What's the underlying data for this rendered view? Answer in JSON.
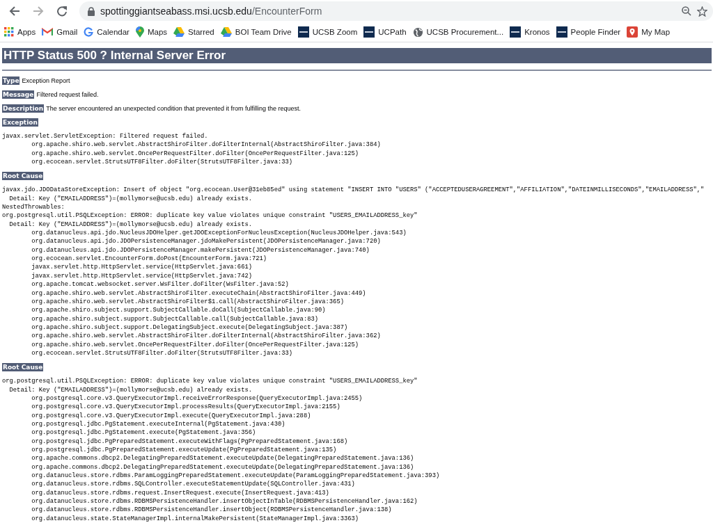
{
  "browser": {
    "back": {
      "disabled": false
    },
    "forward": {
      "disabled": true
    },
    "url": {
      "host": "spottinggiantseabass.msi.ucsb.edu",
      "path": "/EncounterForm"
    },
    "bookmarks": [
      {
        "label": "Apps",
        "kind": "apps"
      },
      {
        "label": "Gmail",
        "kind": "mail"
      },
      {
        "label": "Calendar",
        "kind": "g"
      },
      {
        "label": "Maps",
        "kind": "pin"
      },
      {
        "label": "Starred",
        "kind": "drive"
      },
      {
        "label": "BOI Team Drive",
        "kind": "drive"
      },
      {
        "label": "UCSB Zoom",
        "kind": "square"
      },
      {
        "label": "UCPath",
        "kind": "square"
      },
      {
        "label": "UCSB Procurement...",
        "kind": "globe"
      },
      {
        "label": "Kronos",
        "kind": "square"
      },
      {
        "label": "People Finder",
        "kind": "square"
      },
      {
        "label": "My Map",
        "kind": "redpin"
      }
    ]
  },
  "page": {
    "title": "HTTP Status 500 ? Internal Server Error",
    "fields": [
      {
        "label": "Type",
        "value": "Exception Report"
      },
      {
        "label": "Message",
        "value": "Filtered request failed."
      },
      {
        "label": "Description",
        "value": "The server encountered an unexpected condition that prevented it from fulfilling the request."
      }
    ],
    "sections": [
      {
        "heading": "Exception",
        "lines": [
          "javax.servlet.ServletException: Filtered request failed.",
          "\torg.apache.shiro.web.servlet.AbstractShiroFilter.doFilterInternal(AbstractShiroFilter.java:384)",
          "\torg.apache.shiro.web.servlet.OncePerRequestFilter.doFilter(OncePerRequestFilter.java:125)",
          "\torg.ecocean.servlet.StrutsUTF8Filter.doFilter(StrutsUTF8Filter.java:33)"
        ]
      },
      {
        "heading": "Root Cause",
        "lines": [
          "javax.jdo.JDODataStoreException: Insert of object \"org.ecocean.User@31eb85ed\" using statement \"INSERT INTO \"USERS\" (\"ACCEPTEDUSERAGREEMENT\",\"AFFILIATION\",\"DATEINMILLISECONDS\",\"EMAILADDRESS\",\"",
          "  Detail: Key (\"EMAILADDRESS\")=(mollymorse@ucsb.edu) already exists.",
          "NestedThrowables:",
          "org.postgresql.util.PSQLException: ERROR: duplicate key value violates unique constraint \"USERS_EMAILADDRESS_key\"",
          "  Detail: Key (\"EMAILADDRESS\")=(mollymorse@ucsb.edu) already exists.",
          "\torg.datanucleus.api.jdo.NucleusJDOHelper.getJDOExceptionForNucleusException(NucleusJDOHelper.java:543)",
          "\torg.datanucleus.api.jdo.JDOPersistenceManager.jdoMakePersistent(JDOPersistenceManager.java:720)",
          "\torg.datanucleus.api.jdo.JDOPersistenceManager.makePersistent(JDOPersistenceManager.java:740)",
          "\torg.ecocean.servlet.EncounterForm.doPost(EncounterForm.java:721)",
          "\tjavax.servlet.http.HttpServlet.service(HttpServlet.java:661)",
          "\tjavax.servlet.http.HttpServlet.service(HttpServlet.java:742)",
          "\torg.apache.tomcat.websocket.server.WsFilter.doFilter(WsFilter.java:52)",
          "\torg.apache.shiro.web.servlet.AbstractShiroFilter.executeChain(AbstractShiroFilter.java:449)",
          "\torg.apache.shiro.web.servlet.AbstractShiroFilter$1.call(AbstractShiroFilter.java:365)",
          "\torg.apache.shiro.subject.support.SubjectCallable.doCall(SubjectCallable.java:90)",
          "\torg.apache.shiro.subject.support.SubjectCallable.call(SubjectCallable.java:83)",
          "\torg.apache.shiro.subject.support.DelegatingSubject.execute(DelegatingSubject.java:387)",
          "\torg.apache.shiro.web.servlet.AbstractShiroFilter.doFilterInternal(AbstractShiroFilter.java:362)",
          "\torg.apache.shiro.web.servlet.OncePerRequestFilter.doFilter(OncePerRequestFilter.java:125)",
          "\torg.ecocean.servlet.StrutsUTF8Filter.doFilter(StrutsUTF8Filter.java:33)"
        ]
      },
      {
        "heading": "Root Cause",
        "lines": [
          "org.postgresql.util.PSQLException: ERROR: duplicate key value violates unique constraint \"USERS_EMAILADDRESS_key\"",
          "  Detail: Key (\"EMAILADDRESS\")=(mollymorse@ucsb.edu) already exists.",
          "\torg.postgresql.core.v3.QueryExecutorImpl.receiveErrorResponse(QueryExecutorImpl.java:2455)",
          "\torg.postgresql.core.v3.QueryExecutorImpl.processResults(QueryExecutorImpl.java:2155)",
          "\torg.postgresql.core.v3.QueryExecutorImpl.execute(QueryExecutorImpl.java:288)",
          "\torg.postgresql.jdbc.PgStatement.executeInternal(PgStatement.java:430)",
          "\torg.postgresql.jdbc.PgStatement.execute(PgStatement.java:356)",
          "\torg.postgresql.jdbc.PgPreparedStatement.executeWithFlags(PgPreparedStatement.java:168)",
          "\torg.postgresql.jdbc.PgPreparedStatement.executeUpdate(PgPreparedStatement.java:135)",
          "\torg.apache.commons.dbcp2.DelegatingPreparedStatement.executeUpdate(DelegatingPreparedStatement.java:136)",
          "\torg.apache.commons.dbcp2.DelegatingPreparedStatement.executeUpdate(DelegatingPreparedStatement.java:136)",
          "\torg.datanucleus.store.rdbms.ParamLoggingPreparedStatement.executeUpdate(ParamLoggingPreparedStatement.java:393)",
          "\torg.datanucleus.store.rdbms.SQLController.executeStatementUpdate(SQLController.java:431)",
          "\torg.datanucleus.store.rdbms.request.InsertRequest.execute(InsertRequest.java:413)",
          "\torg.datanucleus.store.rdbms.RDBMSPersistenceHandler.insertObjectInTable(RDBMSPersistenceHandler.java:162)",
          "\torg.datanucleus.store.rdbms.RDBMSPersistenceHandler.insertObject(RDBMSPersistenceHandler.java:138)",
          "\torg.datanucleus.state.StateManagerImpl.internalMakePersistent(StateManagerImpl.java:3363)"
        ]
      }
    ]
  }
}
